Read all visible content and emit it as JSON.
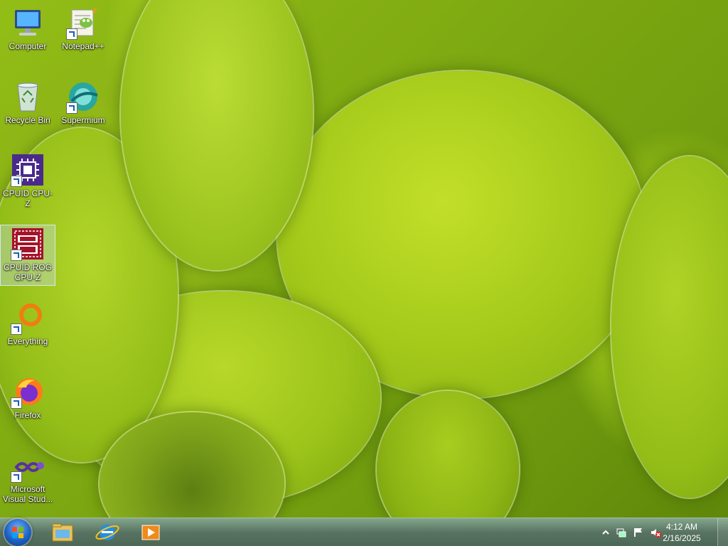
{
  "desktop": {
    "icons": [
      {
        "label": "Computer",
        "icon": "computer-icon"
      },
      {
        "label": "Notepad++",
        "icon": "notepadpp-icon"
      },
      {
        "label": "Recycle Bin",
        "icon": "recycle-bin-icon"
      },
      {
        "label": "Supermium",
        "icon": "supermium-icon"
      },
      {
        "label": "CPUID CPU-Z",
        "icon": "cpuz-icon"
      },
      {
        "label": "CPUID ROG CPU-Z",
        "icon": "rog-cpuz-icon"
      },
      {
        "label": "Everything",
        "icon": "everything-icon"
      },
      {
        "label": "Firefox",
        "icon": "firefox-icon"
      },
      {
        "label": "Microsoft Visual Stud...",
        "icon": "visual-studio-icon"
      }
    ],
    "selected": "CPUID ROG CPU-Z"
  },
  "taskbar": {
    "pinned": [
      "file-explorer-icon",
      "internet-explorer-icon",
      "media-player-icon"
    ],
    "tray": [
      "show-hidden-icons-chevron",
      "network-icon",
      "action-center-flag-icon",
      "volume-muted-icon"
    ],
    "clock": {
      "time": "4:12 AM",
      "date": "2/16/2025"
    }
  },
  "colors": {
    "wallpaper": "#93bd16",
    "taskbar": "#4f7a60",
    "selection": "#cfe0ff"
  }
}
